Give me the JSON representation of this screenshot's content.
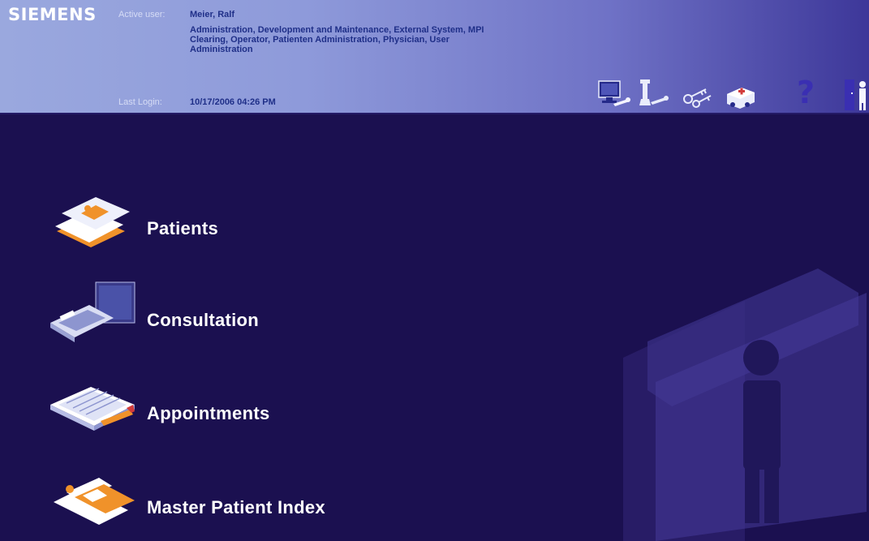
{
  "header": {
    "logo": "SIEMENS",
    "active_user_label": "Active user:",
    "active_user_name": "Meier, Ralf",
    "roles": "Administration, Development and Maintenance, External System, MPI Clearing, Operator, Patienten Administration, Physician, User Administration",
    "last_login_label": "Last Login:",
    "last_login_value": "10/17/2006 04:26 PM"
  },
  "toolbar": {
    "tools": [
      "monitor-wrench-icon",
      "tool-wrench-icon",
      "keys-icon",
      "ambulance-icon",
      "help-icon",
      "user-exit-icon"
    ],
    "help_glyph": "?"
  },
  "menu": {
    "items": [
      {
        "label": "Patients",
        "icon": "patients-icon"
      },
      {
        "label": "Consultation",
        "icon": "consultation-icon"
      },
      {
        "label": "Appointments",
        "icon": "appointments-icon"
      },
      {
        "label": "Master Patient Index",
        "icon": "master-patient-index-icon"
      }
    ]
  },
  "colors": {
    "background": "#1b1050",
    "header_light": "#9aa8de",
    "header_dark": "#3d3799",
    "accent_orange": "#f0922a",
    "text_value": "#1f2f88"
  }
}
